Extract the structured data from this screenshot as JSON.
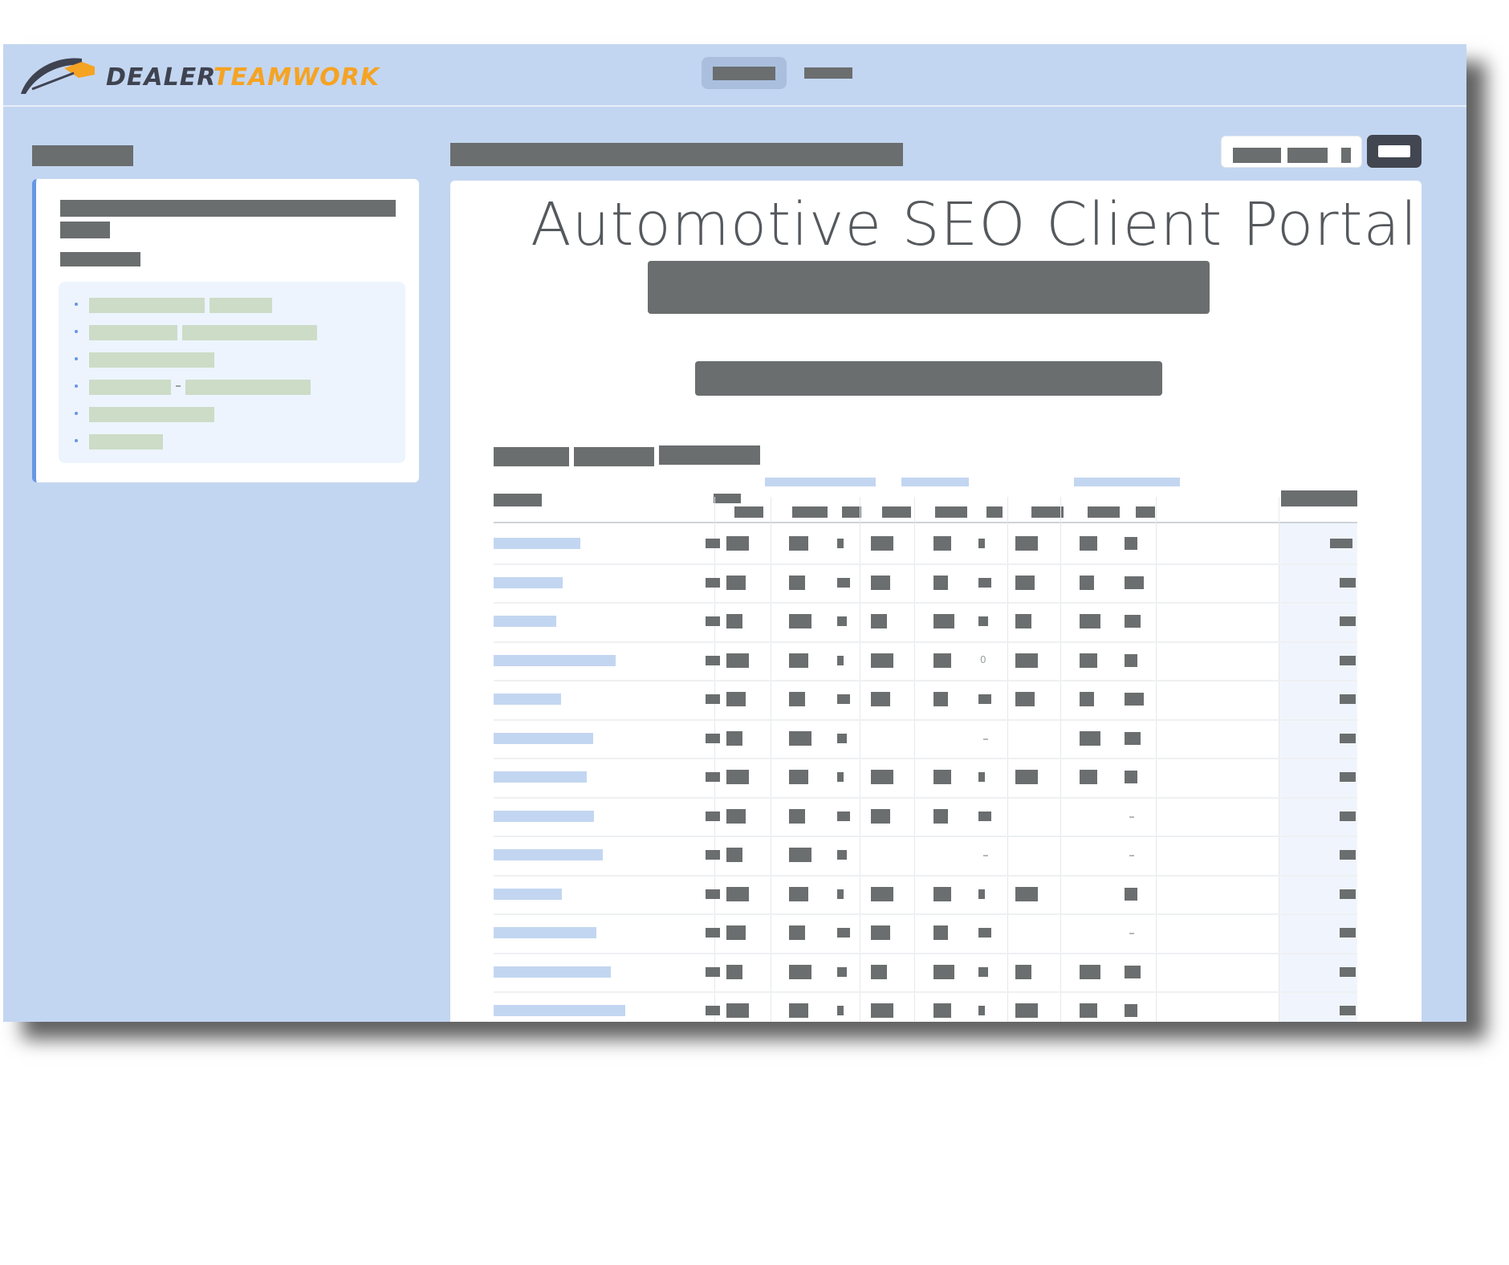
{
  "app": {
    "brand_part1": "DEALER",
    "brand_part2": "TEAMWORK",
    "colors": {
      "frame": "#c3d6f1",
      "accent": "#f5a323",
      "brand_dark": "#3f4350",
      "link": "#6797e4"
    }
  },
  "main": {
    "title": "Automotive SEO Client Portal"
  },
  "icons": {
    "logo": "speedometer-logo-icon",
    "bullet": "bullet-dot-icon"
  },
  "table": {
    "rows": [
      {
        "name_w": 108,
        "zero": false
      },
      {
        "name_w": 86,
        "zero": false
      },
      {
        "name_w": 78,
        "zero": false
      },
      {
        "name_w": 152,
        "zero": true
      },
      {
        "name_w": 84,
        "zero": false
      },
      {
        "name_w": 124,
        "zero": false
      },
      {
        "name_w": 116,
        "zero": false
      },
      {
        "name_w": 125,
        "zero": false
      },
      {
        "name_w": 136,
        "zero": false
      },
      {
        "name_w": 85,
        "zero": false
      },
      {
        "name_w": 128,
        "zero": false
      },
      {
        "name_w": 146,
        "zero": false
      },
      {
        "name_w": 164,
        "zero": false
      }
    ],
    "zero_text": "0"
  }
}
